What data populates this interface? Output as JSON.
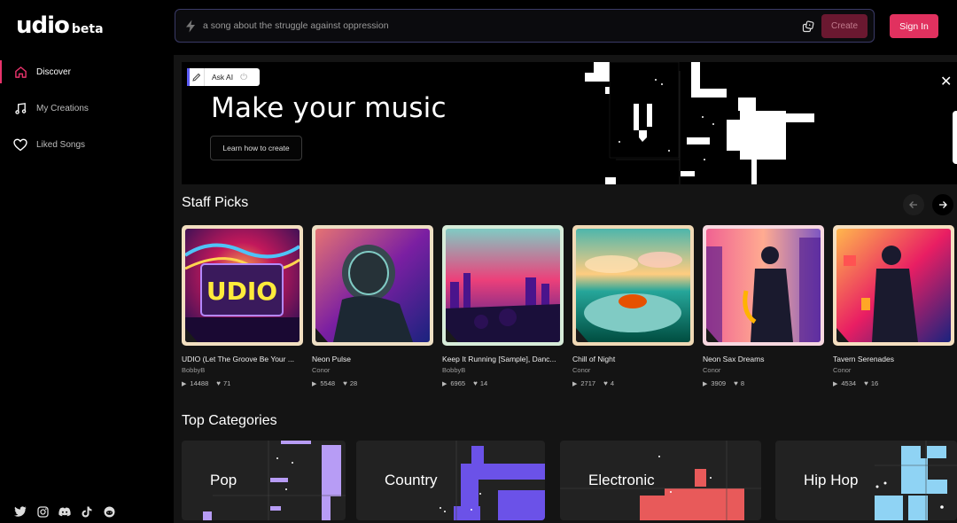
{
  "sidebar": {
    "logo": "udio",
    "logo_suffix": "beta",
    "items": [
      {
        "label": "Discover",
        "icon": "home-icon",
        "active": true
      },
      {
        "label": "My Creations",
        "icon": "music-note-icon",
        "active": false
      },
      {
        "label": "Liked Songs",
        "icon": "heart-icon",
        "active": false
      }
    ],
    "social": [
      "twitter-icon",
      "instagram-icon",
      "discord-icon",
      "tiktok-icon",
      "reddit-icon"
    ]
  },
  "topbar": {
    "prompt_placeholder": "a song about the struggle against oppression",
    "create_label": "Create",
    "signin_label": "Sign In"
  },
  "banner": {
    "ask_ai_label": "Ask AI",
    "title": "Make your music",
    "cta_label": "Learn how to create"
  },
  "staff_picks": {
    "title": "Staff Picks",
    "items": [
      {
        "title": "UDIO (Let The Groove Be Your ...",
        "author": "BobbyB",
        "plays": "14488",
        "likes": "71"
      },
      {
        "title": "Neon Pulse",
        "author": "Conor",
        "plays": "5548",
        "likes": "28"
      },
      {
        "title": "Keep It Running [Sample], Danc...",
        "author": "BobbyB",
        "plays": "6965",
        "likes": "14"
      },
      {
        "title": "Chill of Night",
        "author": "Conor",
        "plays": "2717",
        "likes": "4"
      },
      {
        "title": "Neon Sax Dreams",
        "author": "Conor",
        "plays": "3909",
        "likes": "8"
      },
      {
        "title": "Tavern Serenades",
        "author": "Conor",
        "plays": "4534",
        "likes": "16"
      }
    ]
  },
  "top_categories": {
    "title": "Top Categories",
    "items": [
      {
        "label": "Pop",
        "color": "#b79cf5"
      },
      {
        "label": "Country",
        "color": "#6b52e8"
      },
      {
        "label": "Electronic",
        "color": "#e85a5a"
      },
      {
        "label": "Hip Hop",
        "color": "#8fd3f4"
      }
    ]
  },
  "colors": {
    "accent": "#e1315f",
    "create_disabled": "#6a1830"
  }
}
